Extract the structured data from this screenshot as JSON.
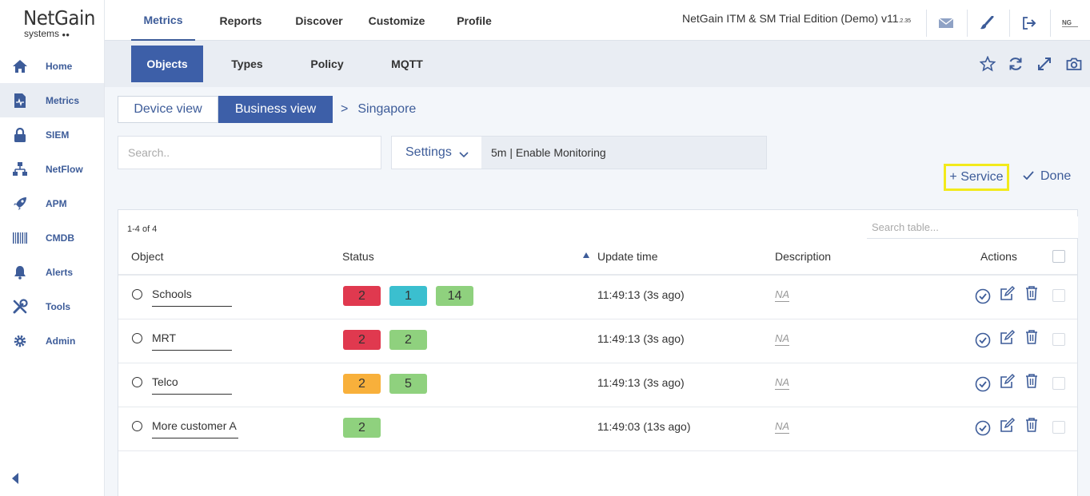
{
  "app": {
    "logo_main": "NetGain",
    "logo_sub": "systems",
    "edition": "NetGain ITM & SM Trial Edition (Demo) v11",
    "version_sub": ".2.35"
  },
  "sidebar": {
    "items": [
      {
        "label": "Home",
        "icon": "home-icon"
      },
      {
        "label": "Metrics",
        "icon": "metrics-icon"
      },
      {
        "label": "SIEM",
        "icon": "lock-icon"
      },
      {
        "label": "NetFlow",
        "icon": "network-icon"
      },
      {
        "label": "APM",
        "icon": "rocket-icon"
      },
      {
        "label": "CMDB",
        "icon": "barcode-icon"
      },
      {
        "label": "Alerts",
        "icon": "bell-icon"
      },
      {
        "label": "Tools",
        "icon": "tools-icon"
      },
      {
        "label": "Admin",
        "icon": "gear-icon"
      }
    ],
    "active": "Metrics"
  },
  "topnav": {
    "tabs": [
      "Metrics",
      "Reports",
      "Discover",
      "Customize",
      "Profile"
    ],
    "active": "Metrics"
  },
  "subnav": {
    "tabs": [
      "Objects",
      "Types",
      "Policy",
      "MQTT"
    ],
    "active": "Objects"
  },
  "view": {
    "device_label": "Device view",
    "business_label": "Business view",
    "breadcrumb_sep": ">",
    "breadcrumb": "Singapore"
  },
  "search": {
    "placeholder": "Search.."
  },
  "settings": {
    "label": "Settings",
    "value": "5m | Enable Monitoring"
  },
  "actions": {
    "service_label": "+ Service",
    "done_label": "Done"
  },
  "table": {
    "count": "1-4 of 4",
    "search_placeholder": "Search table...",
    "headers": {
      "object": "Object",
      "status": "Status",
      "update_time": "Update time",
      "description": "Description",
      "actions": "Actions"
    },
    "rows": [
      {
        "object": "Schools",
        "status": [
          {
            "value": "2",
            "color": "#e0394f"
          },
          {
            "value": "1",
            "color": "#3bbfcf"
          },
          {
            "value": "14",
            "color": "#8fd17e"
          }
        ],
        "update_time": "11:49:13 (3s ago)",
        "description": "NA"
      },
      {
        "object": "MRT",
        "status": [
          {
            "value": "2",
            "color": "#e0394f"
          },
          {
            "value": "2",
            "color": "#8fd17e"
          }
        ],
        "update_time": "11:49:13 (3s ago)",
        "description": "NA"
      },
      {
        "object": "Telco",
        "status": [
          {
            "value": "2",
            "color": "#f8b03b"
          },
          {
            "value": "5",
            "color": "#8fd17e"
          }
        ],
        "update_time": "11:49:13 (3s ago)",
        "description": "NA"
      },
      {
        "object": "More customer A",
        "status": [
          {
            "value": "2",
            "color": "#8fd17e"
          }
        ],
        "update_time": "11:49:03 (13s ago)",
        "description": "NA"
      }
    ]
  },
  "colors": {
    "accent": "#3d5fa8",
    "highlight": "#f2ea1b"
  }
}
